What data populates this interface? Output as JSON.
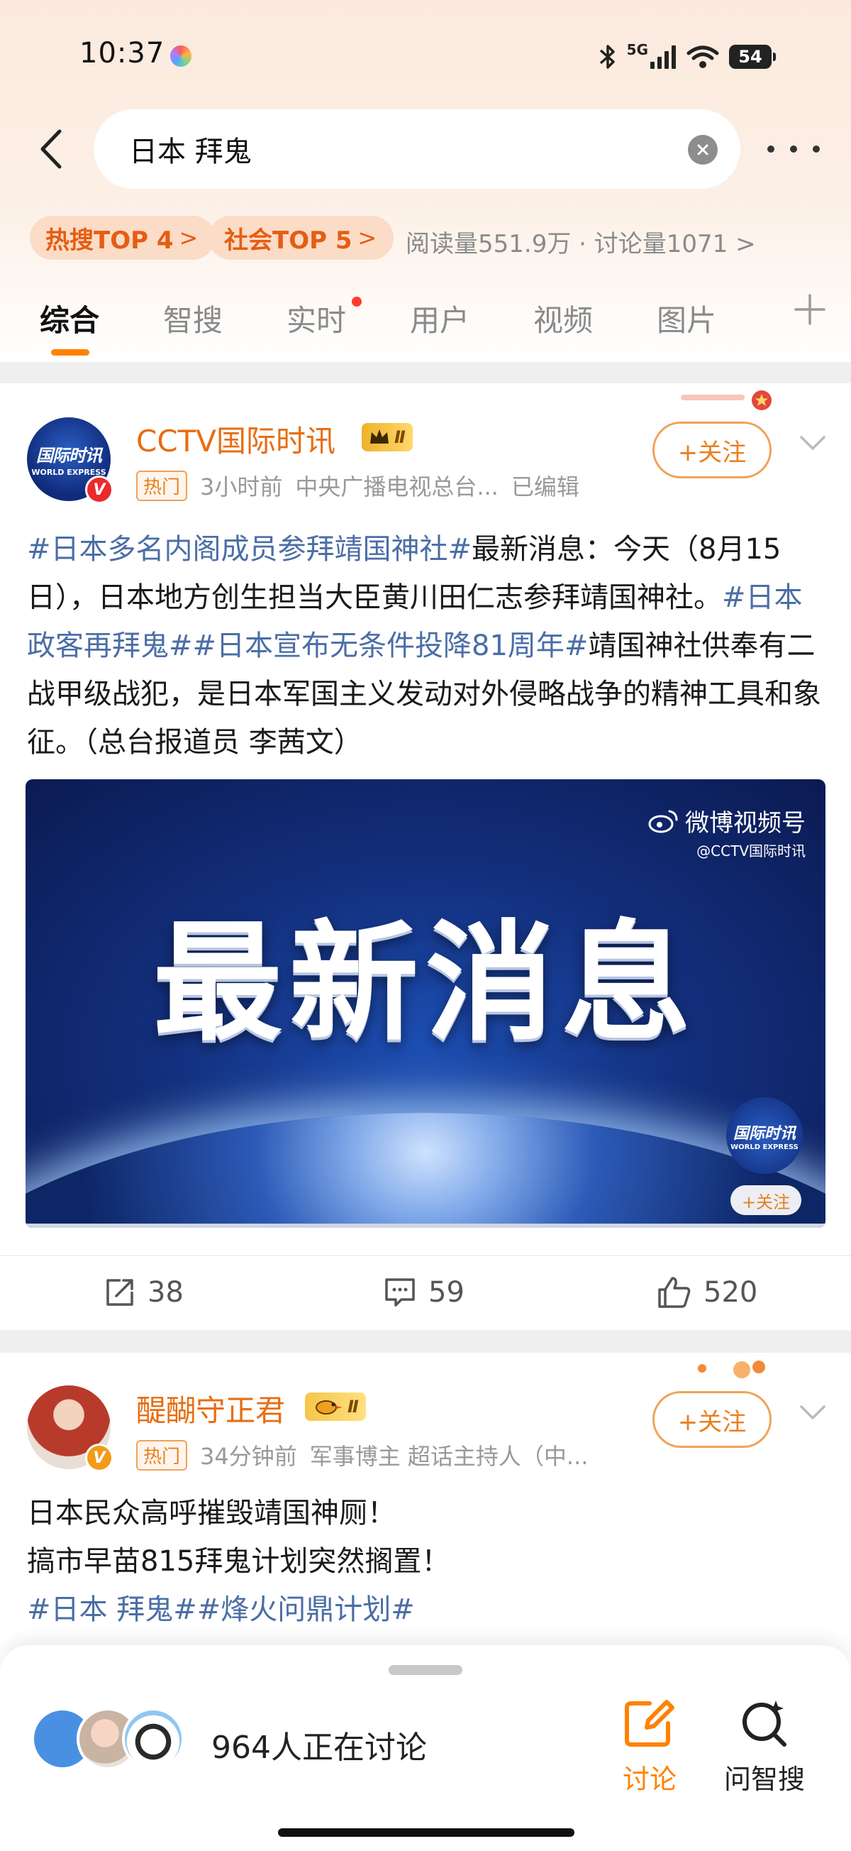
{
  "status_bar": {
    "time": "10:37",
    "network": "5G",
    "battery": "54"
  },
  "search": {
    "query": "日本 拜鬼"
  },
  "tags": {
    "hot_search": "热搜TOP 4",
    "society": "社会TOP 5",
    "stats": "阅读量551.9万 · 讨论量1071"
  },
  "tabs": [
    {
      "label": "综合"
    },
    {
      "label": "智搜"
    },
    {
      "label": "实时"
    },
    {
      "label": "用户"
    },
    {
      "label": "视频"
    },
    {
      "label": "图片"
    }
  ],
  "posts": [
    {
      "avatar_logo_cn": "国际时讯",
      "avatar_logo_en": "WORLD EXPRESS",
      "username": "CCTV国际时讯",
      "level_badge": "Ⅱ",
      "hot_tag": "热门",
      "time": "3小时前",
      "source": "中央广播电视总台...",
      "edited": "已编辑",
      "follow": "+关注",
      "text_topic1": "#日本多名内阁成员参拜靖国神社#",
      "text_part1": "最新消息：今天（8月15日），日本地方创生担当大臣黄川田仁志参拜靖国神社。",
      "text_topic2": "#日本政客再拜鬼#",
      "text_topic3": "#日本宣布无条件投降81周年#",
      "text_part2": "靖国神社供奉有二战甲级战犯，是日本军国主义发动对外侵略战争的精神工具和象征。（总台报道员 李茜文）",
      "media_title": "最新消息",
      "media_watermark": "微博视频号",
      "media_watermark_sub": "@CCTV国际时讯",
      "media_follow": "+关注",
      "reposts": "38",
      "comments": "59",
      "likes": "520"
    },
    {
      "username": "醍醐守正君",
      "level_badge": "Ⅱ",
      "hot_tag": "热门",
      "time": "34分钟前",
      "source": "军事博主 超话主持人（中...",
      "follow": "+关注",
      "line1": "日本民众高呼摧毁靖国神厕！",
      "line2": "搞市早苗815拜鬼计划突然搁置！",
      "topic1": "#日本 拜鬼#",
      "topic2": "#烽火问鼎计划#"
    }
  ],
  "bottom_sheet": {
    "discussing": "964人正在讨论",
    "discuss_label": "讨论",
    "ask_label": "问智搜"
  },
  "colors": {
    "accent": "#ff8200",
    "username": "#e86d12",
    "topic": "#4b6ea6"
  }
}
